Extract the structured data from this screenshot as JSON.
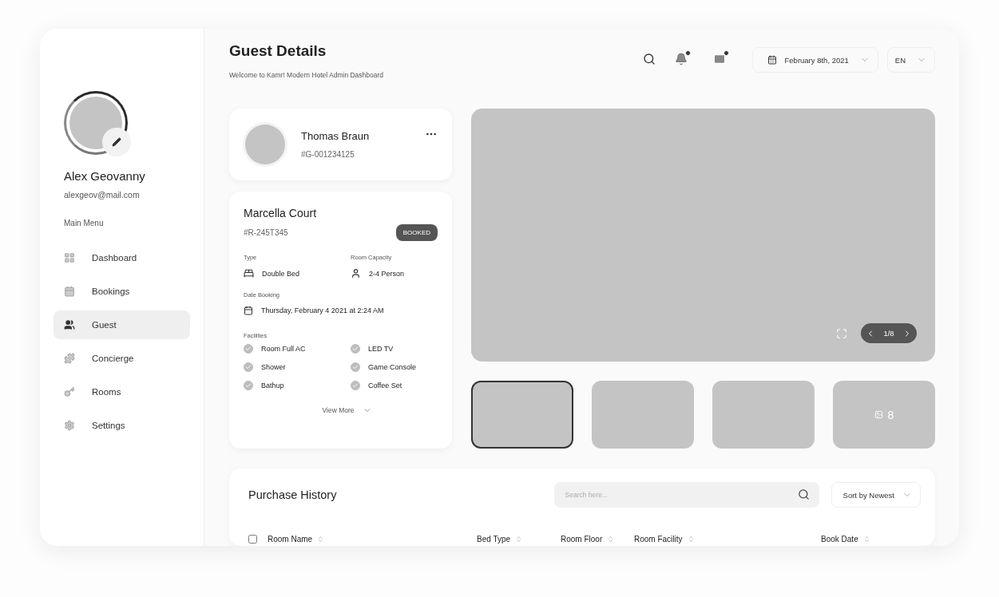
{
  "sidebar": {
    "profile": {
      "name": "Alex Geovanny",
      "email": "alexgeov@mail.com"
    },
    "menu_title": "Main Menu",
    "menu": [
      {
        "label": "Dashboard",
        "selected": false
      },
      {
        "label": "Bookings",
        "selected": false
      },
      {
        "label": "Guest",
        "selected": true
      },
      {
        "label": "Concierge",
        "selected": false
      },
      {
        "label": "Rooms",
        "selected": false
      },
      {
        "label": "Settings",
        "selected": false
      }
    ]
  },
  "header": {
    "title": "Guest Details",
    "subtitle": "Welcome to Kamr! Modern Hotel Admin Dashboard",
    "date": "February 8th, 2021",
    "language": "EN"
  },
  "guest": {
    "name": "Thomas Braun",
    "id": "#G-001234125"
  },
  "room": {
    "name": "Marcella Court",
    "id": "#R-245T345",
    "status": "BOOKED",
    "details": [
      {
        "label": "Type",
        "value": "Double Bed"
      },
      {
        "label": "Room Capacity",
        "value": "2-4 Person"
      }
    ],
    "date_label": "Date Booking",
    "date": "Thursday, February 4 2021 at 2:24 AM",
    "facilities_label": "Facilities",
    "facilities": [
      {
        "label": "Room Full AC",
        "checked": true
      },
      {
        "label": "LED TV",
        "checked": true
      },
      {
        "label": "Shower",
        "checked": true
      },
      {
        "label": "Game Console",
        "checked": true
      },
      {
        "label": "Bathup",
        "checked": true
      },
      {
        "label": "Coffee Set",
        "checked": true
      }
    ],
    "view_more": "View More"
  },
  "gallery": {
    "counter": "1/8",
    "thumbnails": [
      {
        "selected": true
      },
      {
        "selected": false
      },
      {
        "selected": false
      },
      {
        "selected": false,
        "count": "8"
      }
    ]
  },
  "purchase": {
    "title": "Purchase History",
    "search_placeholder": "Search here...",
    "sort": "Sort by Newest",
    "select_all_checked": false,
    "columns": [
      "Room Name",
      "Bed Type",
      "Room Floor",
      "Room Facility",
      "Book Date"
    ]
  }
}
